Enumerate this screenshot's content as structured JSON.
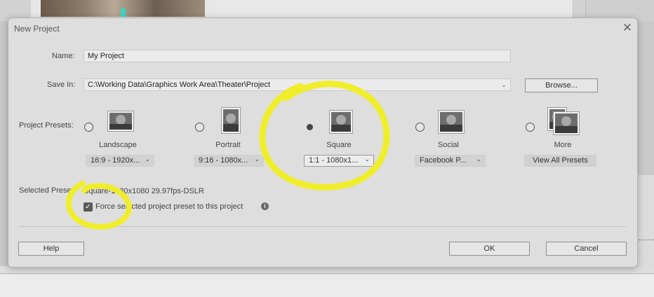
{
  "dialog": {
    "title": "New Project",
    "name_label": "Name:",
    "name_value": "My Project",
    "save_in_label": "Save In:",
    "save_in_value": "C:\\Working Data\\Graphics Work Area\\Theater\\Project",
    "browse_label": "Browse...",
    "presets_label": "Project Presets:",
    "presets": [
      {
        "name": "Landscape",
        "selection": "16:9 - 1920x...",
        "selected": false
      },
      {
        "name": "Portrait",
        "selection": "9:16 - 1080x...",
        "selected": false
      },
      {
        "name": "Square",
        "selection": "1:1 - 1080x1...",
        "selected": true
      },
      {
        "name": "Social",
        "selection": "Facebook P...",
        "selected": false
      },
      {
        "name": "More",
        "selection": "View All Presets",
        "selected": false
      }
    ],
    "selected_preset_label": "Selected Preset:",
    "selected_preset_value": "Square-1080x1080 29.97fps-DSLR",
    "force_label": "Force selected project preset to this project",
    "force_checked": true,
    "help_label": "Help",
    "ok_label": "OK",
    "cancel_label": "Cancel"
  },
  "colors": {
    "annotation": "#f0ee2a",
    "dialog_bg": "#dedede"
  }
}
